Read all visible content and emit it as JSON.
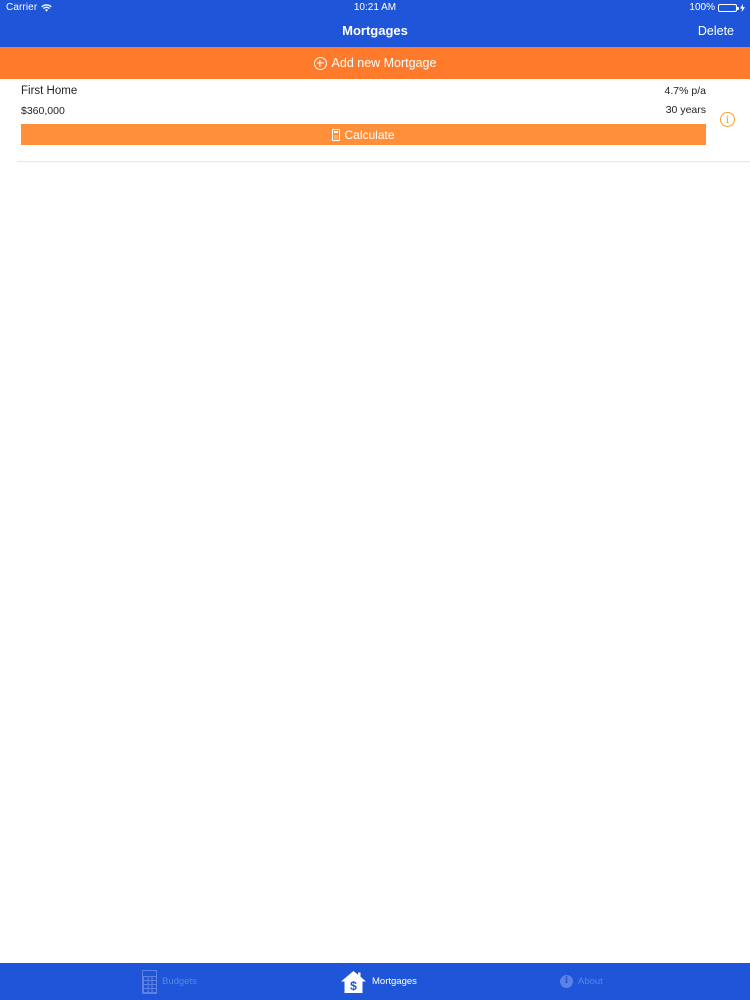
{
  "status_bar": {
    "carrier": "Carrier",
    "time": "10:21 AM",
    "battery": "100%"
  },
  "nav": {
    "title": "Mortgages",
    "delete_label": "Delete"
  },
  "add_bar": {
    "label": "Add new Mortgage"
  },
  "mortgages": [
    {
      "name": "First Home",
      "amount": "$360,000",
      "rate": "4.7% p/a",
      "term": "30 years",
      "calculate_label": "Calculate"
    }
  ],
  "tabs": [
    {
      "label": "Budgets",
      "icon": "grid-icon",
      "selected": false
    },
    {
      "label": "Mortgages",
      "icon": "house-dollar-icon",
      "selected": true
    },
    {
      "label": "About",
      "icon": "info-icon",
      "selected": false
    }
  ],
  "colors": {
    "nav_blue": "#1f56d9",
    "add_orange": "#ff7a2a",
    "calculate_orange": "#ff8f3a",
    "info_orange": "#f0a030",
    "battery_green": "#4cd964",
    "inactive_tab": "#5c83e4"
  }
}
